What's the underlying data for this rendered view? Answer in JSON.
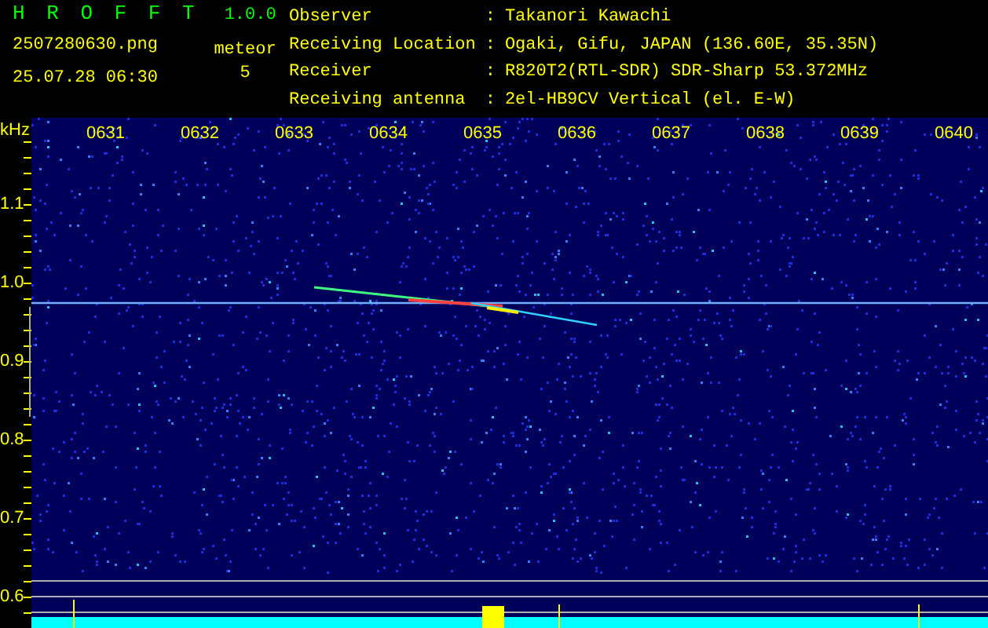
{
  "header": {
    "app_title": "H R O F F T",
    "version": "1.0.0",
    "file_name": "2507280630.png",
    "date_time": "25.07.28 06:30",
    "meteor_label": "meteor",
    "meteor_count": "5"
  },
  "station_info": [
    {
      "label": "Observer",
      "colon": ":",
      "value": "Takanori Kawachi"
    },
    {
      "label": "Receiving Location",
      "colon": ":",
      "value": "Ogaki, Gifu, JAPAN (136.60E, 35.35N)"
    },
    {
      "label": "Receiver",
      "colon": ":",
      "value": "R820T2(RTL-SDR) SDR-Sharp 53.372MHz"
    },
    {
      "label": "Receiving antenna",
      "colon": ":",
      "value": "2el-HB9CV Vertical (el. E-W)"
    }
  ],
  "spectrogram": {
    "unit": "kHz",
    "time_labels": [
      "0631",
      "0632",
      "0633",
      "0634",
      "0635",
      "0636",
      "0637",
      "0638",
      "0639",
      "0640"
    ],
    "frequency_labels": [
      "1.1",
      "1.0",
      "0.9",
      "0.8",
      "0.7",
      "0.6"
    ]
  }
}
